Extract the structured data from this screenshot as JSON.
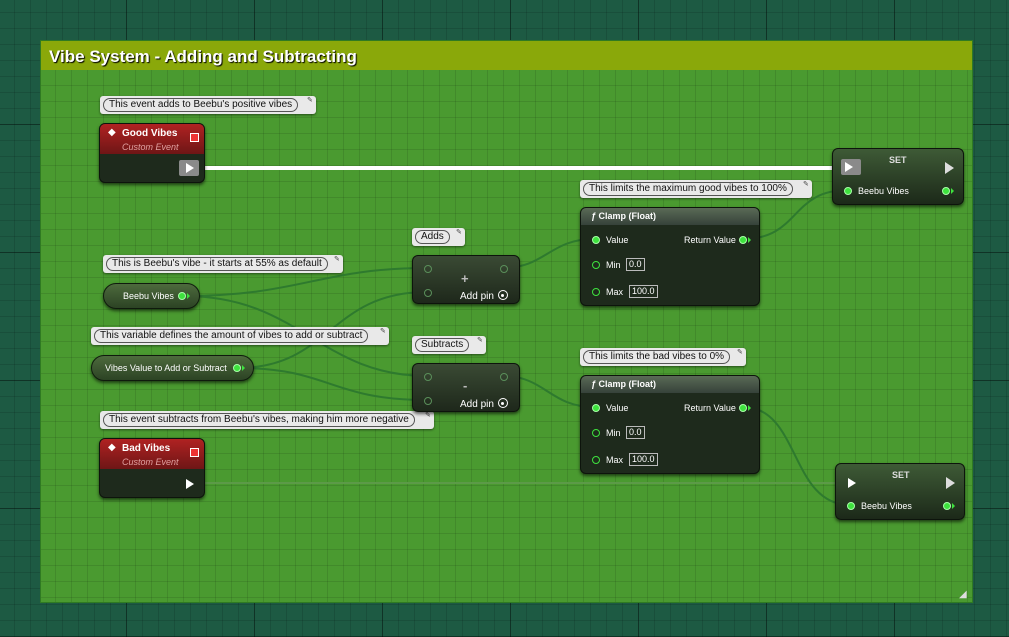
{
  "comment": {
    "title": "Vibe System - Adding and Subtracting"
  },
  "bubbles": {
    "good_vibes": "This event adds to Beebu's positive vibes",
    "beebu_vibe": "This is Beebu's vibe - it starts at 55% as default",
    "vibes_value": "This variable defines the amount of vibes to add or subtract",
    "bad_vibes": "This event subtracts from Beebu's vibes, making him more negative",
    "adds": "Adds",
    "subtracts": "Subtracts",
    "clamp_top": "This limits the maximum good vibes to 100%",
    "clamp_bottom": "This limits the bad vibes to 0%"
  },
  "events": {
    "good": {
      "title": "Good Vibes",
      "subtitle": "Custom Event"
    },
    "bad": {
      "title": "Bad Vibes",
      "subtitle": "Custom Event"
    }
  },
  "variables": {
    "beebu_vibes": "Beebu Vibes",
    "vibes_value": "Vibes Value to Add or Subtract"
  },
  "add_node": {
    "operator": "+",
    "add_pin": "Add pin"
  },
  "subtract_node": {
    "operator": "-",
    "add_pin": "Add pin"
  },
  "clamp_top": {
    "title": "Clamp (Float)",
    "value": "Value",
    "return": "Return Value",
    "min_label": "Min",
    "min": "0.0",
    "max_label": "Max",
    "max": "100.0"
  },
  "clamp_bottom": {
    "title": "Clamp (Float)",
    "value": "Value",
    "return": "Return Value",
    "min_label": "Min",
    "min": "0.0",
    "max_label": "Max",
    "max": "100.0"
  },
  "set_top": {
    "title": "SET",
    "var": "Beebu Vibes"
  },
  "set_bottom": {
    "title": "SET",
    "var": "Beebu Vibes"
  },
  "colors": {
    "comment_header": "#8aa80a",
    "comment_body": "#4a9a30",
    "float_pin": "#3ee23e",
    "event_header": "#b02222",
    "background": "#1d5a43"
  },
  "icons": {
    "event": "event-diamond-icon",
    "function": "function-f-icon",
    "comment_pin": "comment-pin-icon",
    "delegate": "delegate-square-icon"
  }
}
